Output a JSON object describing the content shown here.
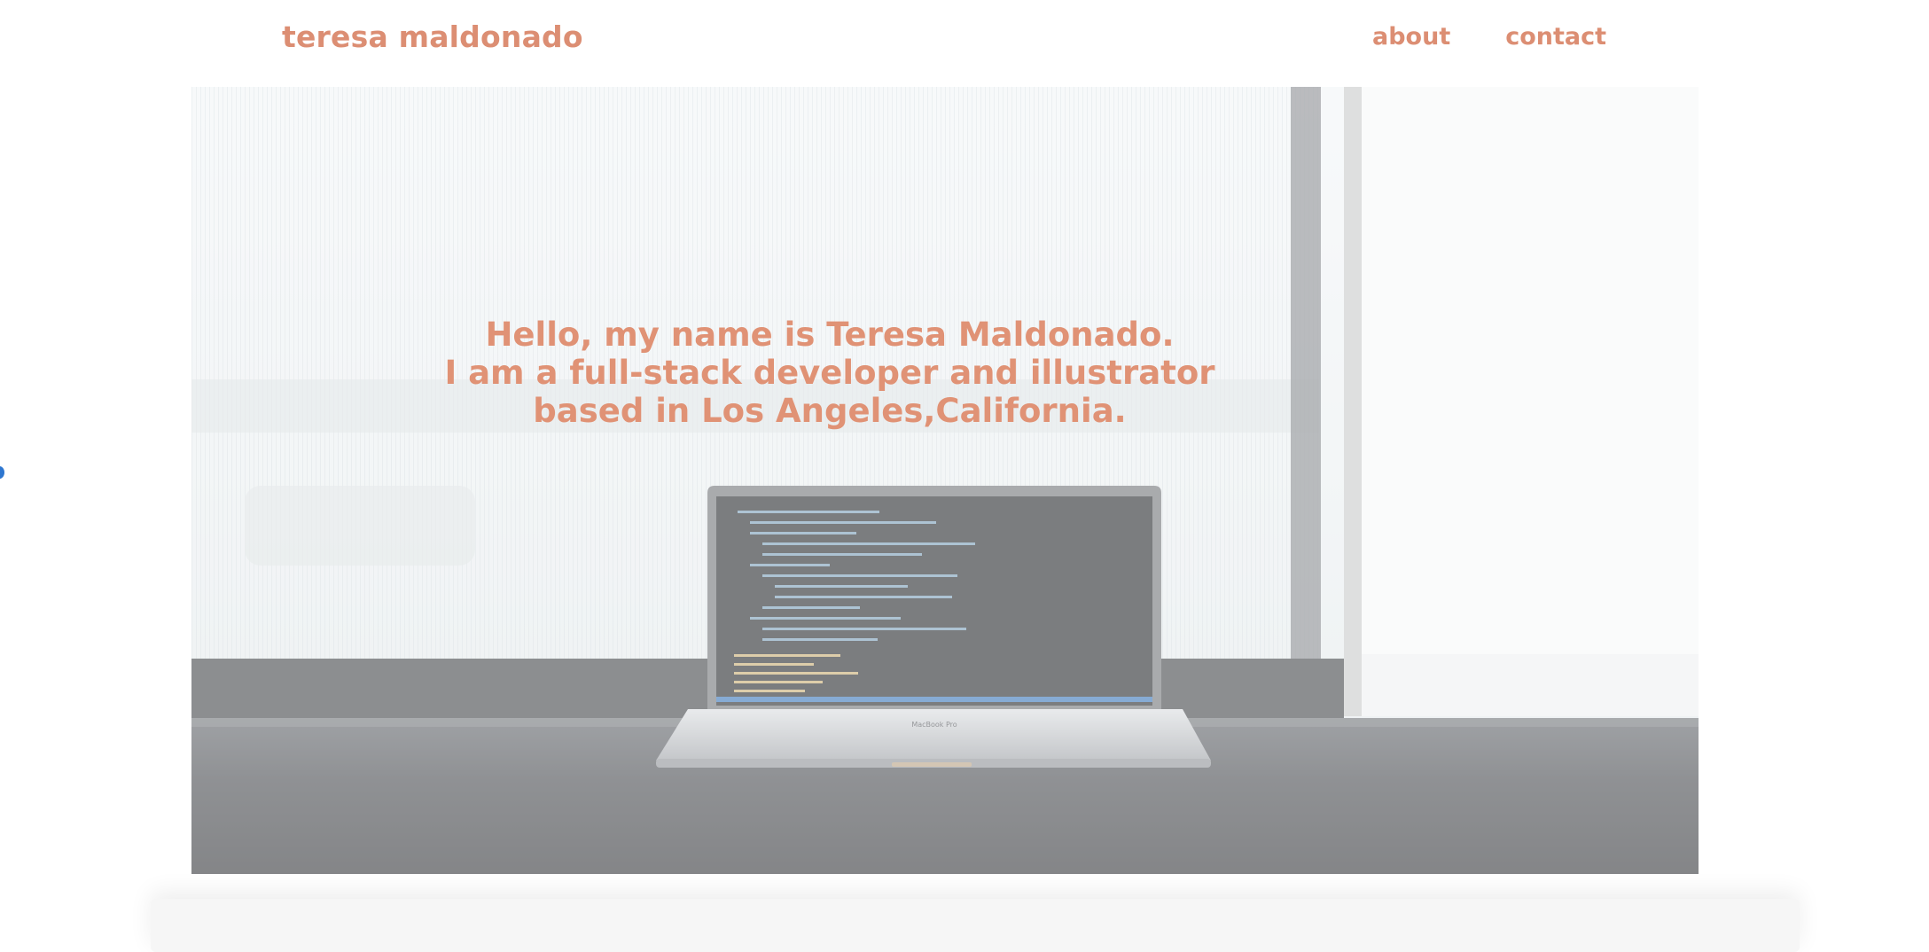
{
  "header": {
    "brand": "teresa maldonado",
    "nav": [
      {
        "label": "about"
      },
      {
        "label": "contact"
      }
    ]
  },
  "hero": {
    "lines": [
      "Hello, my name is Teresa Maldonado.",
      "I am a full-stack developer and illustrator",
      "based in Los Angeles,California."
    ],
    "image_description_icon": "laptop-photo",
    "laptop_label": "MacBook Pro"
  },
  "colors": {
    "accent": "#dc8e73",
    "desk": "#3a3d42",
    "screen": "#1d2024",
    "page": "#ffffff"
  }
}
